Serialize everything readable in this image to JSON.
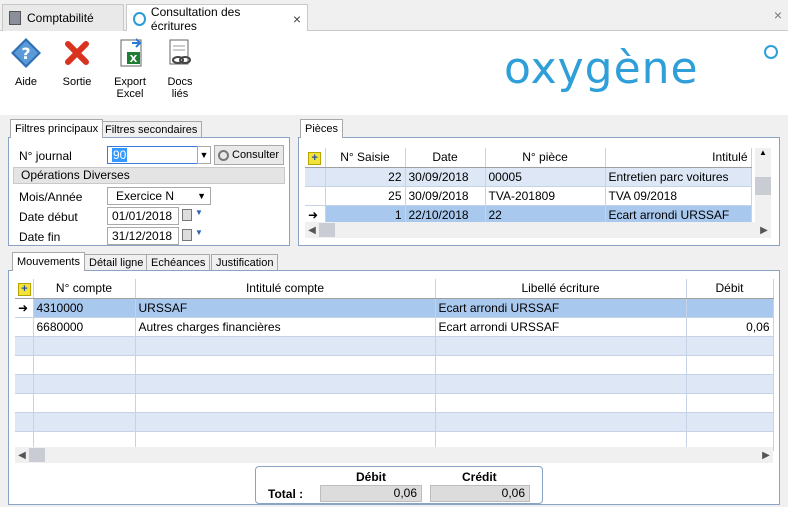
{
  "tabs": [
    {
      "label": "Comptabilité"
    },
    {
      "label": "Consultation des écritures",
      "close": "×"
    }
  ],
  "window_close": "×",
  "toolbar": {
    "aide": "Aide",
    "sortie": "Sortie",
    "export_l1": "Export",
    "export_l2": "Excel",
    "docs_l1": "Docs",
    "docs_l2": "liés"
  },
  "logo": "oxygène",
  "filters": {
    "tab_principal": "Filtres principaux",
    "tab_secondaire": "Filtres secondaires",
    "journal_label": "N° journal",
    "journal_value": "90",
    "consulter": "Consulter",
    "journal_name": "Opérations Diverses",
    "mois_label": "Mois/Année",
    "mois_value": "Exercice N",
    "date_debut_label": "Date début",
    "date_debut_value": "01/01/2018",
    "date_fin_label": "Date fin",
    "date_fin_value": "31/12/2018"
  },
  "pieces": {
    "tab": "Pièces",
    "columns": [
      "N° Saisie",
      "Date",
      "N° pièce",
      "Intitulé"
    ],
    "rows": [
      {
        "saisie": "22",
        "date": "30/09/2018",
        "piece": "00005",
        "intitule": "Entretien parc voitures"
      },
      {
        "saisie": "25",
        "date": "30/09/2018",
        "piece": "TVA-201809",
        "intitule": "TVA 09/2018"
      },
      {
        "saisie": "1",
        "date": "22/10/2018",
        "piece": "22",
        "intitule": "Ecart arrondi URSSAF"
      }
    ]
  },
  "mouvements": {
    "tabs": [
      "Mouvements",
      "Détail ligne",
      "Echéances",
      "Justification"
    ],
    "columns": [
      "N° compte",
      "Intitulé compte",
      "Libellé écriture",
      "Débit"
    ],
    "rows": [
      {
        "compte": "4310000",
        "intitule": "URSSAF",
        "libelle": "Ecart arrondi URSSAF",
        "debit": ""
      },
      {
        "compte": "6680000",
        "intitule": "Autres charges financières",
        "libelle": "Ecart arrondi URSSAF",
        "debit": "0,06"
      }
    ]
  },
  "totals": {
    "debit_label": "Débit",
    "credit_label": "Crédit",
    "total_label": "Total :",
    "debit": "0,06",
    "credit": "0,06"
  }
}
